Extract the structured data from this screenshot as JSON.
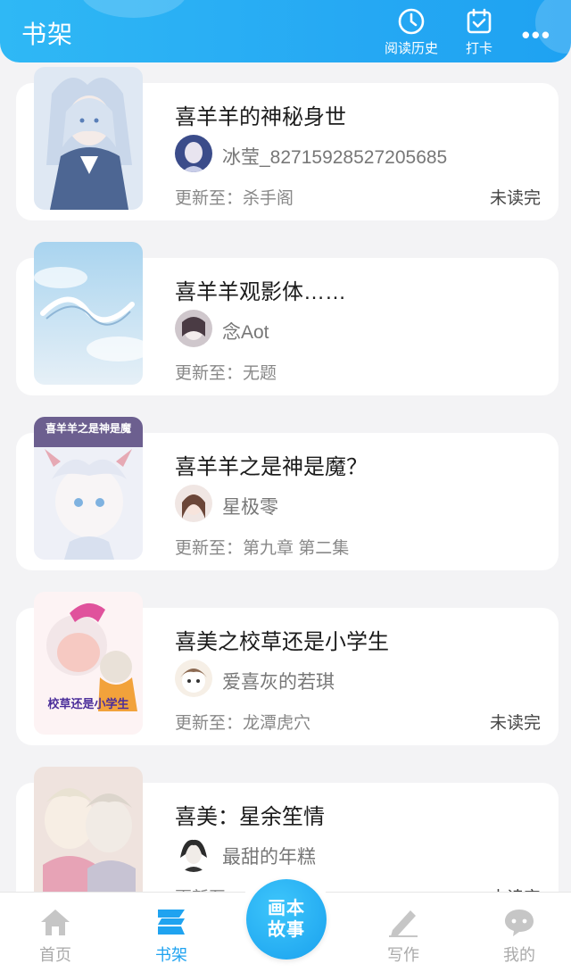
{
  "header": {
    "title": "书架",
    "history_label": "阅读历史",
    "checkin_label": "打卡",
    "more_label": "•••"
  },
  "books": [
    {
      "title": "喜羊羊的神秘身世",
      "author": "冰莹_82715928527205685",
      "update": "更新至：杀手阁",
      "status": "未读完"
    },
    {
      "title": "喜羊羊观影体……",
      "author": "念Aot",
      "update": "更新至：无题",
      "status": ""
    },
    {
      "title": "喜羊羊之是神是魔？",
      "author": "星极零",
      "update": "更新至：第九章 第二集",
      "status": ""
    },
    {
      "title": "喜美之校草还是小学生",
      "author": "爱喜灰的若琪",
      "update": "更新至：龙潭虎穴",
      "status": "未读完"
    },
    {
      "title": "喜美：星余笙情",
      "author": "最甜的年糕",
      "update": "更新至",
      "status": "未读完"
    }
  ],
  "covers": {
    "book3_text": "喜羊羊之是神是魔",
    "book4_text": "校草还是小学生"
  },
  "nav": {
    "home": "首页",
    "shelf": "书架",
    "center_line1": "画本",
    "center_line2": "故事",
    "write": "写作",
    "mine": "我的"
  },
  "colors": {
    "accent": "#1fa3f0",
    "header": "#26a9f3"
  }
}
